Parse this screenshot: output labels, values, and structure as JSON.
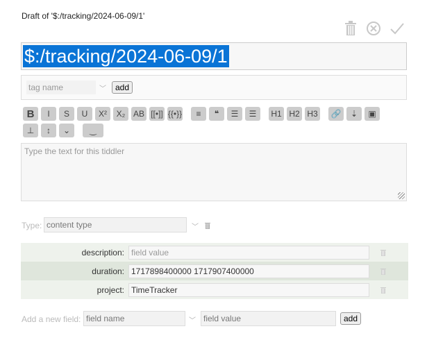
{
  "header": {
    "draft_title": "Draft of '$:/tracking/2024-06-09/1'",
    "icons": [
      "delete-icon",
      "cancel-icon",
      "save-icon"
    ]
  },
  "title_field": {
    "value": "$:/tracking/2024-06-09/1"
  },
  "tags": {
    "placeholder": "tag name",
    "add_label": "add"
  },
  "toolbar": {
    "row1": [
      {
        "name": "bold",
        "label": "B"
      },
      {
        "name": "italic",
        "label": "I"
      },
      {
        "name": "strikethrough",
        "label": "S"
      },
      {
        "name": "underline",
        "label": "U"
      },
      {
        "name": "superscript",
        "label": "X²"
      },
      {
        "name": "subscript",
        "label": "X₂"
      },
      {
        "name": "smallcaps",
        "label": "AB"
      },
      {
        "name": "transclude",
        "label": "[[•]]"
      },
      {
        "name": "macro",
        "label": "{{•}}"
      },
      {
        "name": "monospaced",
        "label": "≡"
      },
      {
        "name": "quote",
        "label": "❝"
      },
      {
        "name": "bullet-list",
        "label": "☰"
      },
      {
        "name": "numbered-list",
        "label": "☰"
      },
      {
        "name": "heading-1",
        "label": "H1"
      },
      {
        "name": "heading-2",
        "label": "H2"
      },
      {
        "name": "heading-3",
        "label": "H3"
      },
      {
        "name": "link",
        "label": "🔗"
      },
      {
        "name": "excise",
        "label": "⇣"
      },
      {
        "name": "picture",
        "label": "▣"
      }
    ],
    "row2": [
      {
        "name": "stamp",
        "label": "⊥"
      },
      {
        "name": "size",
        "label": "↕"
      },
      {
        "name": "more",
        "label": "⌄"
      },
      {
        "name": "preview",
        "label": "‿"
      }
    ]
  },
  "body": {
    "placeholder": "Type the text for this tiddler"
  },
  "type_field": {
    "label": "Type:",
    "placeholder": "content type"
  },
  "fields": [
    {
      "name": "description:",
      "value": "",
      "placeholder": "field value"
    },
    {
      "name": "duration:",
      "value": "1717898400000 1717907400000",
      "placeholder": ""
    },
    {
      "name": "project:",
      "value": "TimeTracker",
      "placeholder": ""
    }
  ],
  "new_field": {
    "label": "Add a new field:",
    "name_placeholder": "field name",
    "value_placeholder": "field value",
    "add_label": "add"
  }
}
